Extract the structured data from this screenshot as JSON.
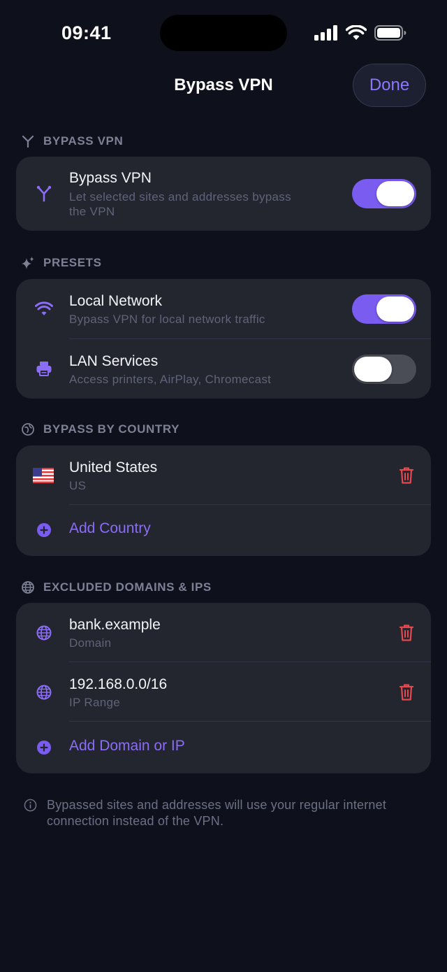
{
  "status_bar": {
    "time": "09:41"
  },
  "header": {
    "title": "Bypass VPN",
    "done_label": "Done"
  },
  "sections": {
    "bypass": {
      "heading": "BYPASS VPN",
      "row": {
        "title": "Bypass VPN",
        "subtitle_line1": "Let selected sites and addresses bypass",
        "subtitle_line2": "the VPN",
        "enabled": true
      }
    },
    "presets": {
      "heading": "PRESETS",
      "items": [
        {
          "title": "Local Network",
          "subtitle": "Bypass VPN for local network traffic",
          "enabled": true
        },
        {
          "title": "LAN Services",
          "subtitle": "Access printers, AirPlay, Chromecast",
          "enabled": false
        }
      ]
    },
    "country": {
      "heading": "BYPASS BY COUNTRY",
      "items": [
        {
          "title": "United States",
          "subtitle": "US"
        }
      ],
      "add_label": "Add Country"
    },
    "domains": {
      "heading": "EXCLUDED DOMAINS & IPS",
      "items": [
        {
          "title": "bank.example",
          "subtitle": "Domain"
        },
        {
          "title": "192.168.0.0/16",
          "subtitle": "IP Range"
        }
      ],
      "add_label": "Add Domain or IP"
    }
  },
  "footnote": {
    "line1": "Bypassed sites and addresses will use your regular internet",
    "line2": "connection instead of the VPN."
  },
  "colors": {
    "accent": "#7a5cf0",
    "accent_text": "#8b6df7",
    "danger": "#e5484d",
    "background": "#0e111c",
    "card": "#23252f"
  }
}
